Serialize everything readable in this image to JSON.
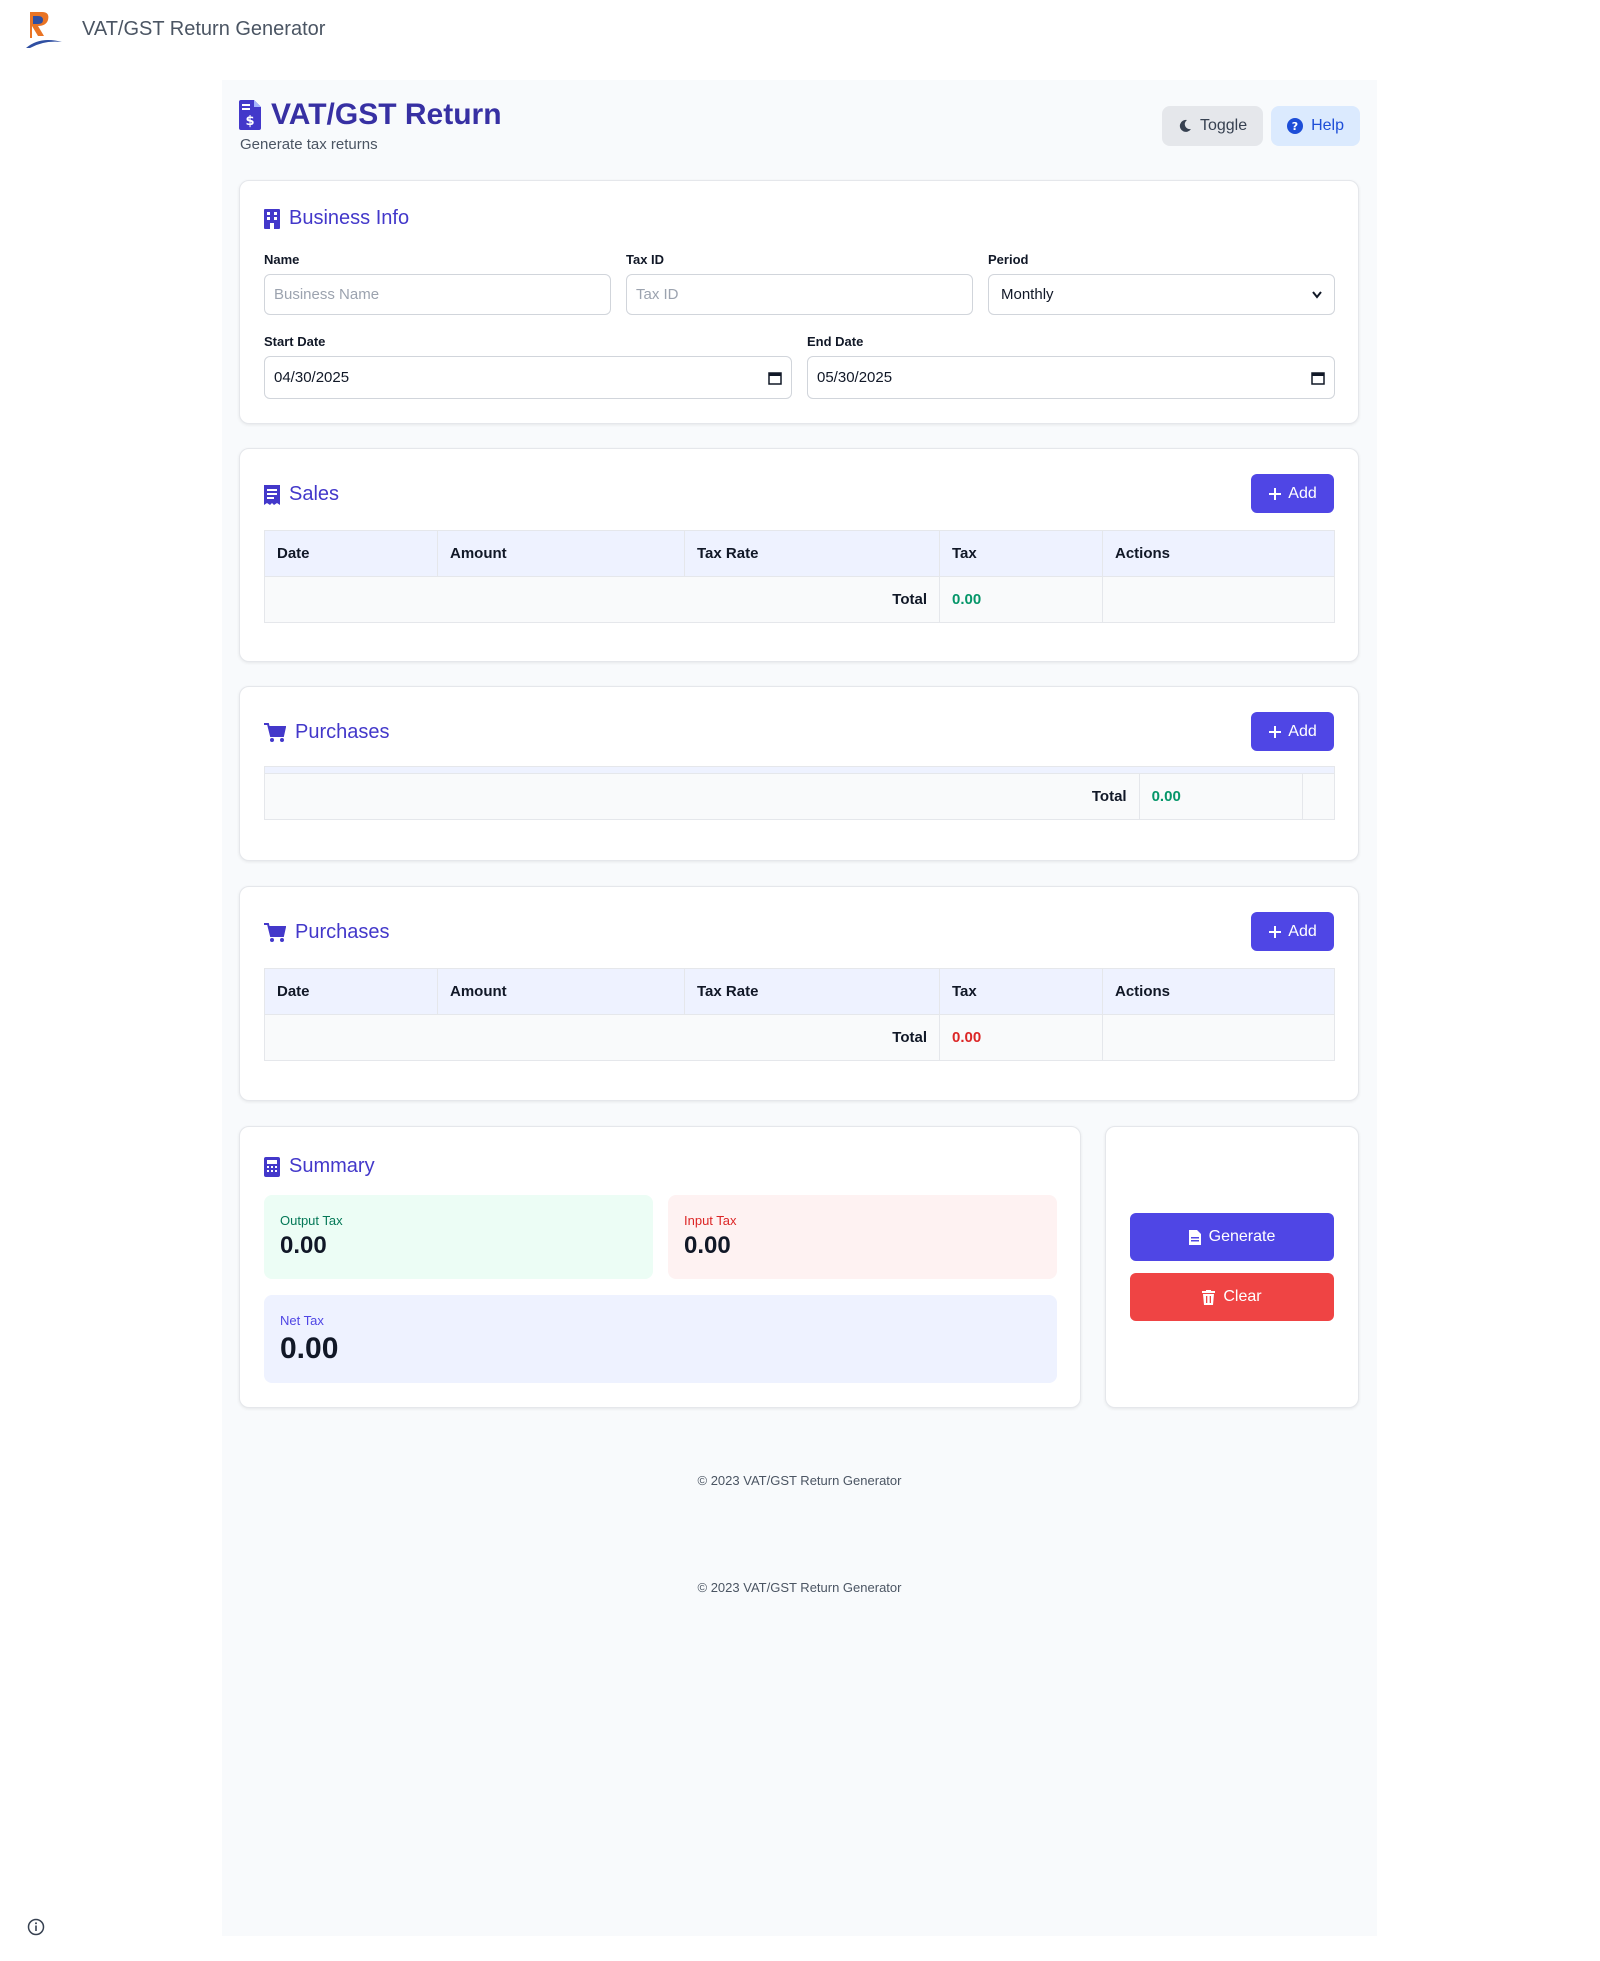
{
  "browser": {
    "app_title": "VAT/GST Return Generator"
  },
  "header": {
    "title": "VAT/GST Return",
    "subtitle": "Generate tax returns",
    "toggle_label": "Toggle",
    "help_label": "Help"
  },
  "business_info": {
    "title": "Business Info",
    "name_label": "Name",
    "name_placeholder": "Business Name",
    "taxid_label": "Tax ID",
    "taxid_placeholder": "Tax ID",
    "period_label": "Period",
    "period_value": "Monthly",
    "start_label": "Start Date",
    "start_value": "04/30/2025",
    "end_label": "End Date",
    "end_value": "05/30/2025"
  },
  "sales": {
    "title": "Sales",
    "add_label": "Add",
    "columns": [
      "Date",
      "Amount",
      "Tax Rate",
      "Tax",
      "Actions"
    ],
    "total_label": "Total",
    "total_value": "0.00"
  },
  "purchases_1": {
    "title": "Purchases",
    "add_label": "Add",
    "total_label": "Total",
    "total_value": "0.00"
  },
  "purchases_2": {
    "title": "Purchases",
    "add_label": "Add",
    "columns": [
      "Date",
      "Amount",
      "Tax Rate",
      "Tax",
      "Actions"
    ],
    "total_label": "Total",
    "total_value": "0.00"
  },
  "summary": {
    "title": "Summary",
    "output_label": "Output Tax",
    "output_value": "0.00",
    "input_label": "Input Tax",
    "input_value": "0.00",
    "net_label": "Net Tax",
    "net_value": "0.00"
  },
  "actions": {
    "generate_label": "Generate",
    "clear_label": "Clear"
  },
  "footer": {
    "text_1": "© 2023 VAT/GST Return Generator",
    "text_2": "© 2023 VAT/GST Return Generator"
  },
  "colors": {
    "primary": "#4f46e5",
    "title": "#3730a3",
    "danger": "#ef4444",
    "positive": "#059669",
    "negative": "#dc2626"
  }
}
